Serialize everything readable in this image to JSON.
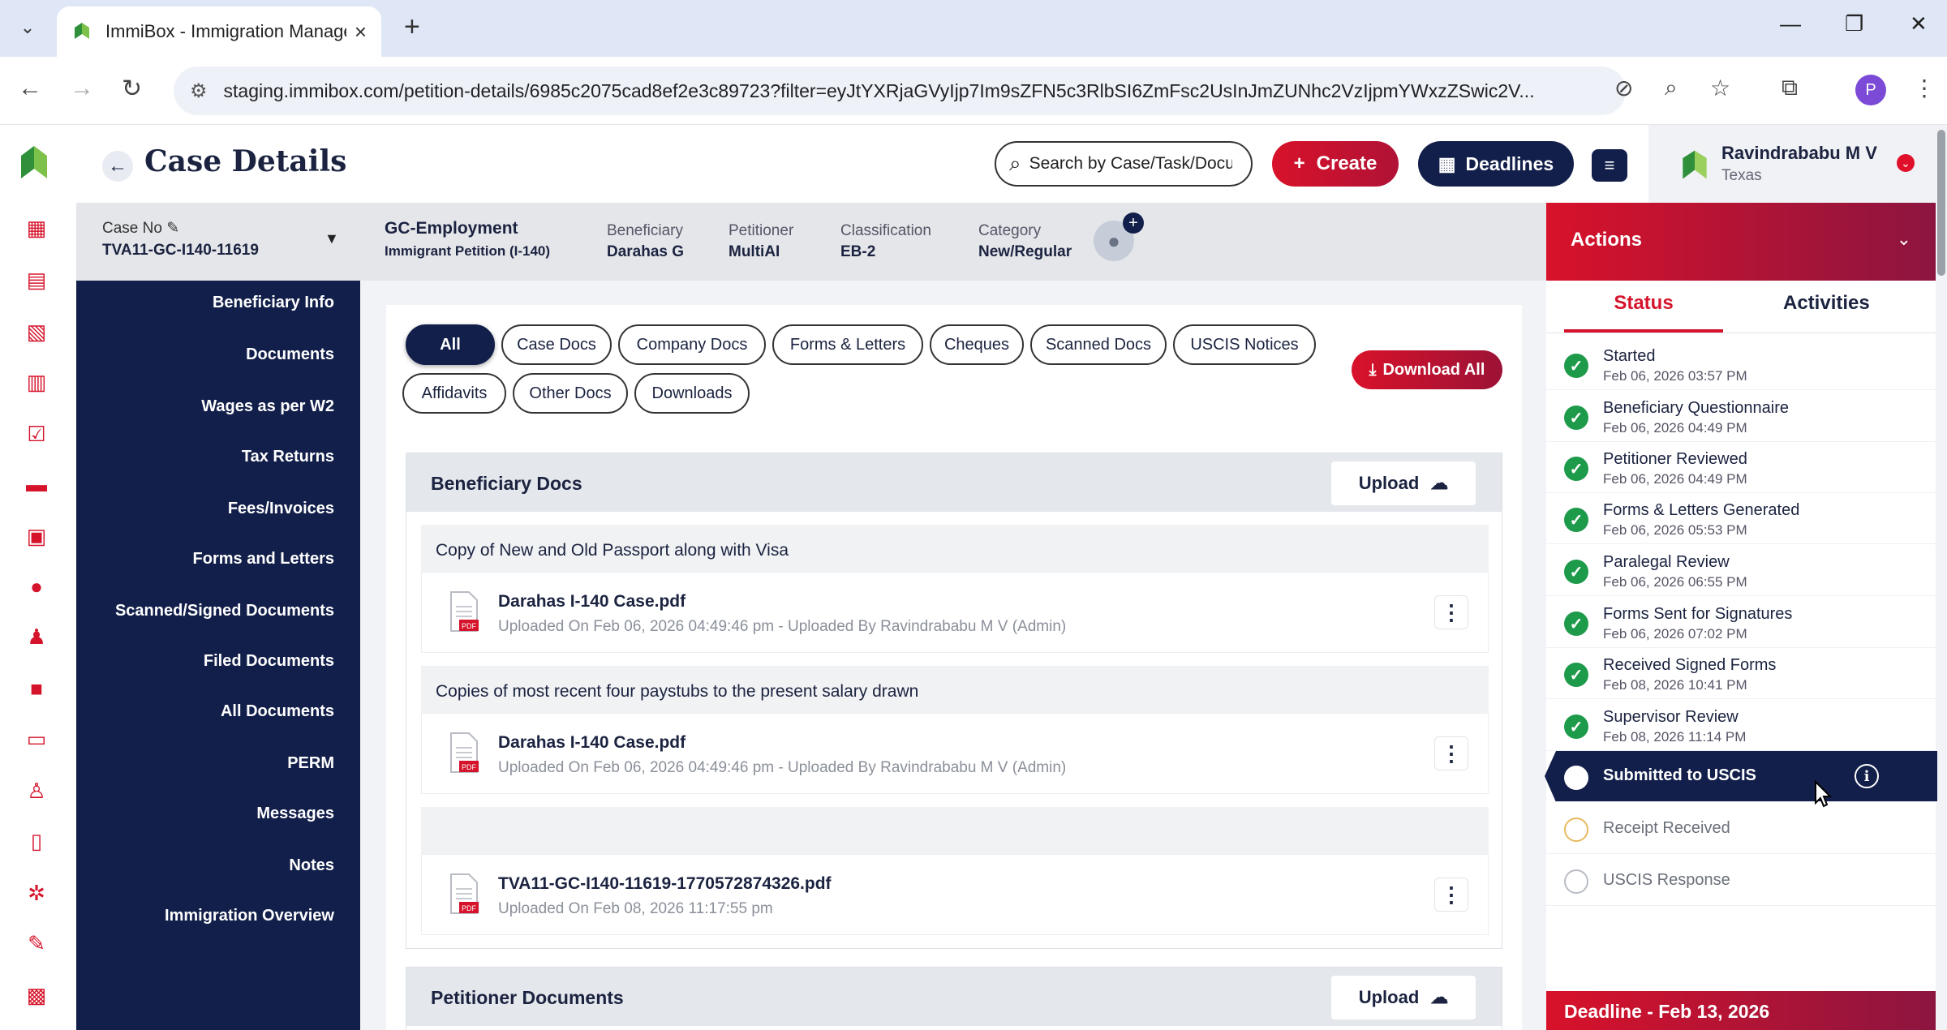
{
  "browser": {
    "tab_title": "ImmiBox - Immigration Manage",
    "url": "staging.immibox.com/petition-details/6985c2075cad8ef2e3c89723?filter=eyJtYXRjaGVyIjp7Im9sZFN5c3RlbSI6ZmFsc2UsInJmZUNhc2VzIjpmYWxzZSwic2V...",
    "profile_initial": "P"
  },
  "header": {
    "title": "Case Details",
    "search_placeholder": "Search by Case/Task/Docu",
    "create_label": "Create",
    "deadlines_label": "Deadlines",
    "user_name": "Ravindrababu M V",
    "user_location": "Texas"
  },
  "case": {
    "no_label": "Case No",
    "no_value": "TVA11-GC-I140-11619",
    "type": "GC-Employment",
    "subtype": "Immigrant Petition (I-140)",
    "beneficiary_label": "Beneficiary",
    "beneficiary_value": "Darahas G",
    "petitioner_label": "Petitioner",
    "petitioner_value": "MultiAI",
    "classification_label": "Classification",
    "classification_value": "EB-2",
    "category_label": "Category",
    "category_value": "New/Regular"
  },
  "nav": {
    "items": [
      "Beneficiary Info",
      "Documents",
      "Wages as per W2",
      "Tax Returns",
      "Fees/Invoices",
      "Forms and Letters",
      "Scanned/Signed Documents",
      "Filed Documents",
      "All Documents",
      "PERM",
      "Messages",
      "Notes",
      "Immigration Overview"
    ]
  },
  "filters": {
    "chips": [
      "All",
      "Case Docs",
      "Company Docs",
      "Forms & Letters",
      "Cheques",
      "Scanned Docs",
      "USCIS Notices",
      "Affidavits",
      "Other Docs",
      "Downloads"
    ],
    "active": "All",
    "download_all_label": "Download All"
  },
  "sections": {
    "beneficiary": {
      "title": "Beneficiary Docs",
      "upload_label": "Upload",
      "groups": [
        {
          "title": "Copy of New and Old Passport along with Visa",
          "file": "Darahas I-140 Case.pdf",
          "meta": "Uploaded On Feb 06, 2026 04:49:46 pm - Uploaded By Ravindrababu M V (Admin)"
        },
        {
          "title": "Copies of most recent four paystubs to the present salary drawn",
          "file": "Darahas I-140 Case.pdf",
          "meta": "Uploaded On Feb 06, 2026 04:49:46 pm - Uploaded By Ravindrababu M V (Admin)"
        },
        {
          "title": "",
          "file": "TVA11-GC-I140-11619-1770572874326.pdf",
          "meta": "Uploaded On Feb 08, 2026 11:17:55 pm"
        }
      ]
    },
    "petitioner": {
      "title": "Petitioner Documents",
      "upload_label": "Upload"
    }
  },
  "actions": {
    "title": "Actions",
    "tab_status": "Status",
    "tab_activities": "Activities",
    "steps": [
      {
        "name": "Started",
        "date": "Feb 06, 2026 03:57 PM",
        "state": "done"
      },
      {
        "name": "Beneficiary Questionnaire",
        "date": "Feb 06, 2026 04:49 PM",
        "state": "done"
      },
      {
        "name": "Petitioner Reviewed",
        "date": "Feb 06, 2026 04:49 PM",
        "state": "done"
      },
      {
        "name": "Forms & Letters Generated",
        "date": "Feb 06, 2026 05:53 PM",
        "state": "done"
      },
      {
        "name": "Paralegal Review",
        "date": "Feb 06, 2026 06:55 PM",
        "state": "done"
      },
      {
        "name": "Forms Sent for Signatures",
        "date": "Feb 06, 2026 07:02 PM",
        "state": "done"
      },
      {
        "name": "Received Signed Forms",
        "date": "Feb 08, 2026 10:41 PM",
        "state": "done"
      },
      {
        "name": "Supervisor Review",
        "date": "Feb 08, 2026 11:14 PM",
        "state": "done"
      },
      {
        "name": "Submitted to USCIS",
        "date": "",
        "state": "current"
      },
      {
        "name": "Receipt Received",
        "date": "",
        "state": "pending"
      },
      {
        "name": "USCIS Response",
        "date": "",
        "state": "pending"
      }
    ],
    "deadline": "Deadline - Feb 13, 2026"
  },
  "colors": {
    "navy": "#121f4a",
    "brand_red": "#d5142b",
    "success_green": "#1d9a4a"
  }
}
